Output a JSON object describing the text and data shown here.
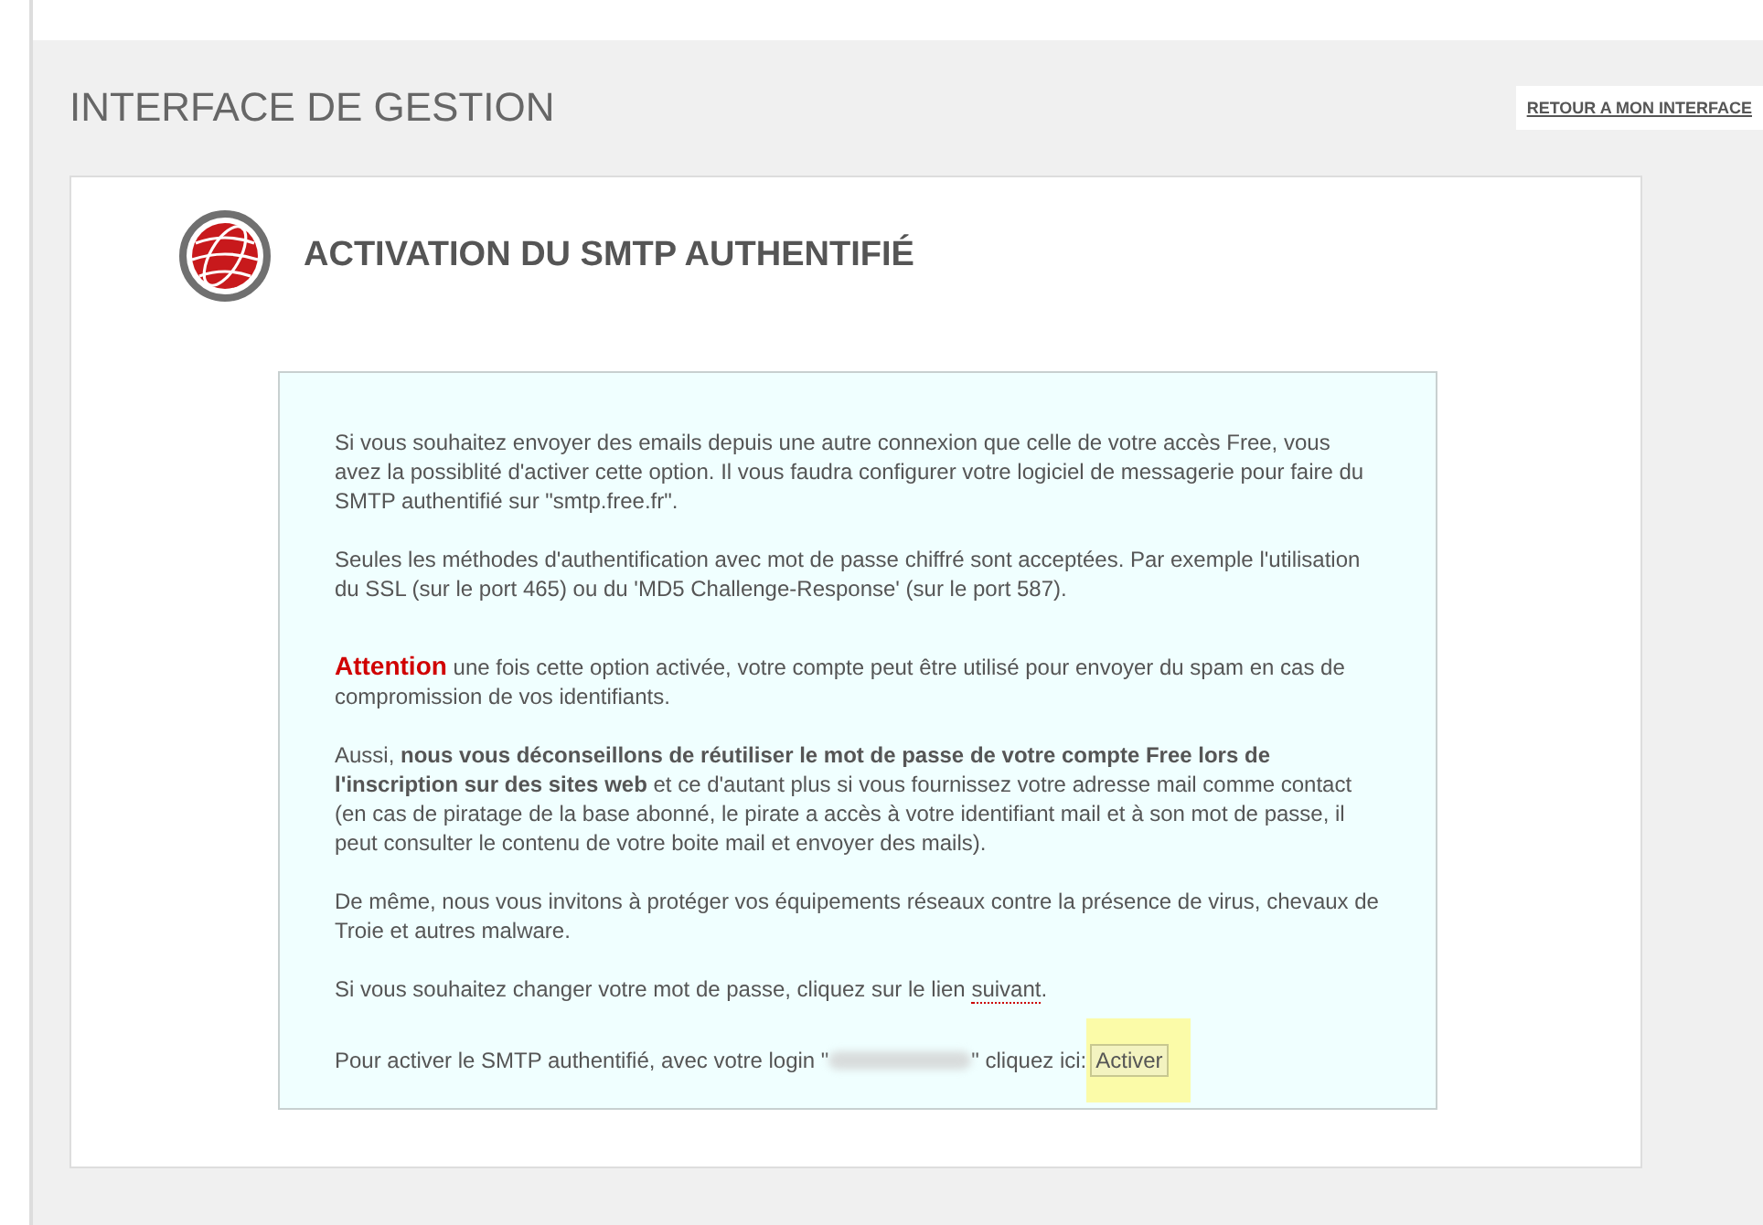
{
  "page_title": "INTERFACE DE GESTION",
  "back_button": "RETOUR A MON INTERFACE",
  "section_title": "ACTIVATION DU SMTP AUTHENTIFIÉ",
  "paragraphs": [
    {
      "kind": "text",
      "text": "Si vous souhaitez envoyer des emails depuis une autre connexion que celle de votre accès Free, vous avez la possiblité d'activer cette option. Il vous faudra configurer votre logiciel de messagerie pour faire du SMTP authentifié sur \"smtp.free.fr\"."
    },
    {
      "kind": "text",
      "text": "Seules les méthodes d'authentification avec mot de passe chiffré sont acceptées. Par exemple l'utilisation du SSL (sur le port 465) ou du 'MD5 Challenge-Response' (sur le port 587)."
    },
    {
      "kind": "alert",
      "label": "Attention",
      "text": "une fois cette option activée, votre compte peut être utilisé pour envoyer du spam en cas de compromission de vos identifiants."
    },
    {
      "kind": "text",
      "text": "Aussi, **nous vous déconseillons de réutiliser le mot de passe de votre compte Free lors de l'inscription sur des sites web** et ce d'autant plus si vous fournissez votre adresse mail comme contact (en cas de piratage de la base abonné, le pirate a accès à votre identifiant mail et à son mot de passe, il peut consulter le contenu de votre boite mail et envoyer des mails)."
    },
    {
      "kind": "text",
      "text": "De même, nous vous invitons à protéger vos équipements réseaux contre la présence de virus, chevaux de Troie et autres malware."
    },
    {
      "kind": "link",
      "before": "Si vous souhaitez changer votre mot de passe, cliquez sur le lien ",
      "link": "suivant",
      "after": "."
    },
    {
      "kind": "action",
      "before": "Pour activer le SMTP authentifié, avec votre login \"",
      "after": "\" cliquez ici:",
      "button": "Activer"
    }
  ]
}
